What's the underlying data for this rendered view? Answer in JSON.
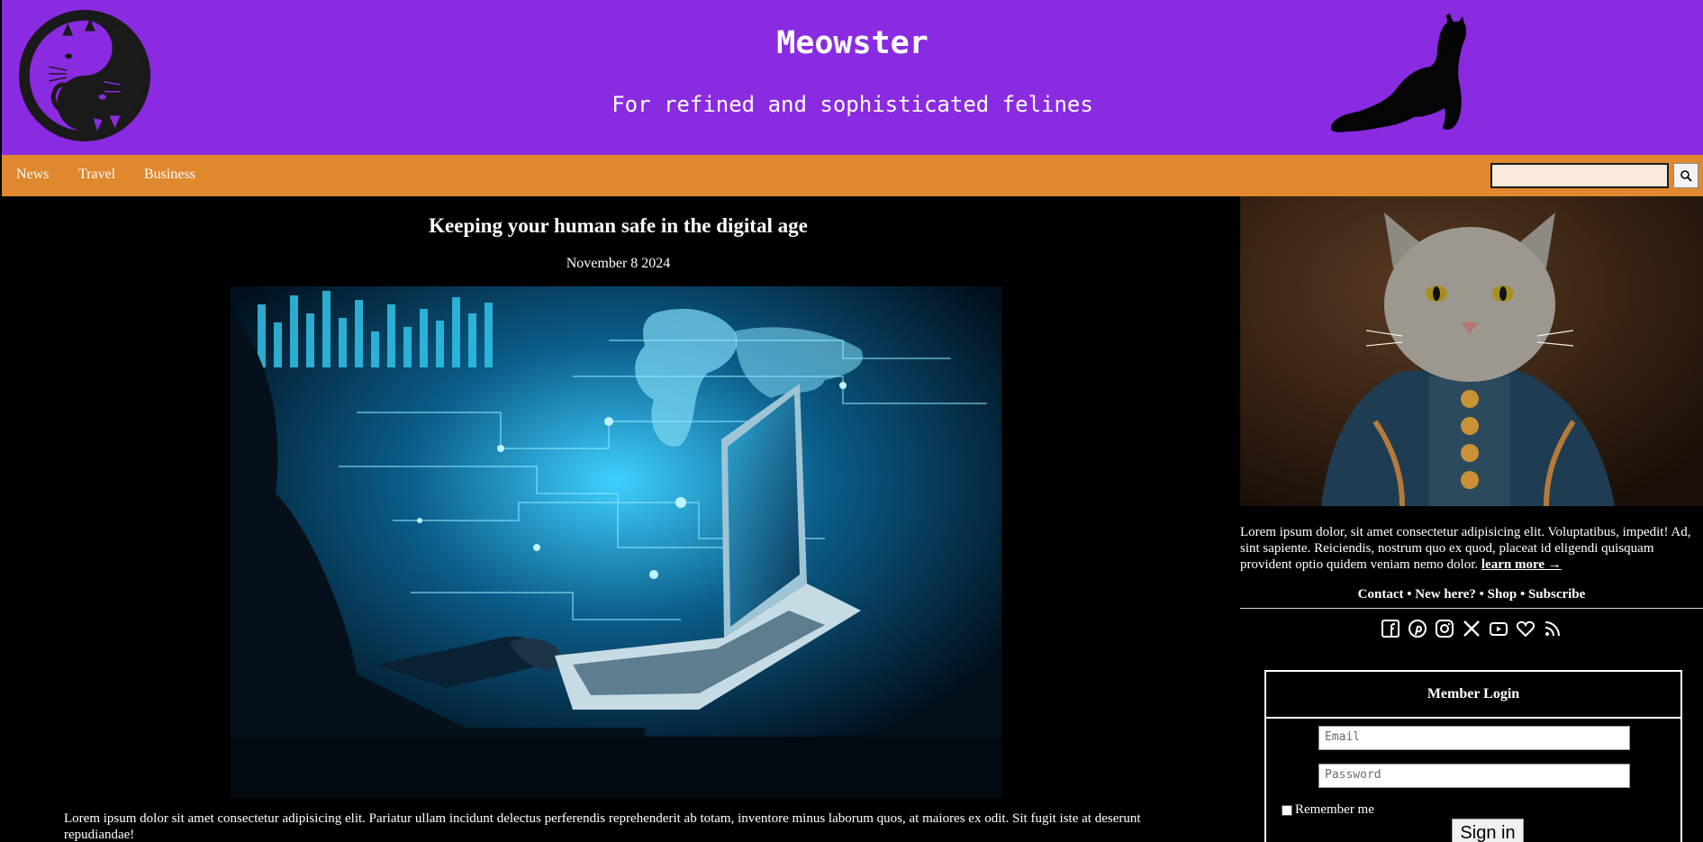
{
  "header": {
    "site_title": "Meowster",
    "tagline": "For refined and sophisticated felines",
    "brand_color": "#8a2be2"
  },
  "nav": {
    "items": [
      "News",
      "Travel",
      "Business"
    ],
    "search_value": "",
    "color": "#e0882e"
  },
  "article": {
    "title": "Keeping your human safe in the digital age",
    "date": "November 8 2024",
    "body": "Lorem ipsum dolor sit amet consectetur adipisicing elit. Pariatur ullam incidunt delectus perferendis reprehenderit ab totam, inventore minus laborum quos, at maiores ex odit. Sit fugit iste at deserunt repudiandae!"
  },
  "sidebar": {
    "intro": "Lorem ipsum dolor, sit amet consectetur adipisicing elit. Voluptatibus, impedit! Ad, sint sapiente. Reiciendis, nostrum quo ex quod, placeat id eligendi quisquam provident optio quidem veniam nemo dolor.",
    "learn_more": "learn more →",
    "links": [
      "Contact",
      "New here?",
      "Shop",
      "Subscribe"
    ],
    "separator": "•",
    "social_icons": [
      "facebook-icon",
      "pinterest-icon",
      "instagram-icon",
      "x-icon",
      "youtube-icon",
      "heart-icon",
      "rss-icon"
    ]
  },
  "login": {
    "heading": "Member Login",
    "email_placeholder": "Email",
    "password_placeholder": "Password",
    "remember_label": "Remember me",
    "signin_label": "Sign in"
  }
}
